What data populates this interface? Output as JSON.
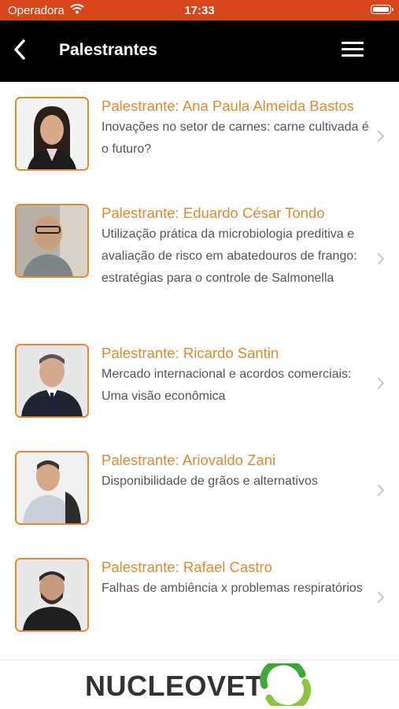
{
  "status_bar": {
    "carrier": "Operadora",
    "time": "17:33"
  },
  "header": {
    "title": "Palestrantes"
  },
  "speakers": [
    {
      "name": "Palestrante: Ana Paula Almeida Bastos",
      "talk": "Inovações no setor de carnes: carne cultivada é o futuro? "
    },
    {
      "name": "Palestrante: Eduardo César Tondo",
      "talk": "Utilização prática da microbiologia preditiva e avaliação de risco em abatedouros de frango: estratégias para o controle de Salmonella"
    },
    {
      "name": "Palestrante: Ricardo Santin",
      "talk": "Mercado internacional e acordos comerciais: Uma visão econômica"
    },
    {
      "name": "Palestrante: Ariovaldo Zani",
      "talk": "Disponibilidade de grãos e alternativos"
    },
    {
      "name": "Palestrante: Rafael Castro",
      "talk": "Falhas de ambiência x problemas respiratórios"
    }
  ],
  "footer": {
    "brand": "NUCLEOVET"
  },
  "colors": {
    "status_bar": "#d8471c",
    "accent": "#e28a2f",
    "nav_bar": "#000000",
    "logo_green": "#3aa935"
  }
}
